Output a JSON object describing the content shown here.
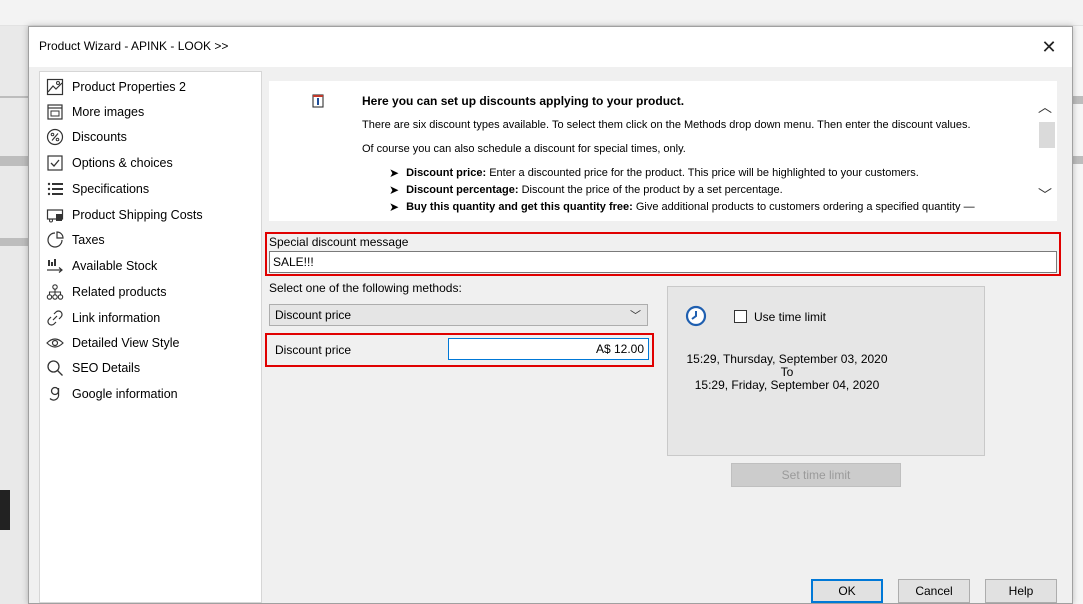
{
  "dialog": {
    "title": "Product Wizard - APINK - LOOK >>",
    "close": "✕"
  },
  "nav": {
    "items": [
      {
        "label": "Product Properties 2",
        "icon": "image-icon"
      },
      {
        "label": "More images",
        "icon": "gallery-icon"
      },
      {
        "label": "Discounts",
        "icon": "percent-icon"
      },
      {
        "label": "Options & choices",
        "icon": "checkbox-icon"
      },
      {
        "label": "Specifications",
        "icon": "list-icon"
      },
      {
        "label": "Product Shipping Costs",
        "icon": "truck-icon"
      },
      {
        "label": "Taxes",
        "icon": "pie-icon"
      },
      {
        "label": "Available Stock",
        "icon": "stock-icon"
      },
      {
        "label": "Related products",
        "icon": "hierarchy-icon"
      },
      {
        "label": "Link information",
        "icon": "link-icon"
      },
      {
        "label": "Detailed View Style",
        "icon": "eye-icon"
      },
      {
        "label": "SEO Details",
        "icon": "search-icon"
      },
      {
        "label": "Google information",
        "icon": "google-icon"
      }
    ]
  },
  "help": {
    "heading": "Here you can set up discounts applying to your product.",
    "p1": "There are six discount types available. To select them click on the Methods drop down menu. Then enter the discount values.",
    "p2": "Of course you can also schedule a discount for special times, only.",
    "bullets": [
      {
        "term": "Discount price:",
        "text": "Enter a discounted price for the product. This price will be highlighted to your customers."
      },
      {
        "term": "Discount percentage:",
        "text": "Discount the price of the product by a set percentage."
      },
      {
        "term": "Buy this quantity and get this quantity free:",
        "text": "Give additional products to customers ordering a specified quantity —"
      }
    ]
  },
  "discount_message": {
    "label": "Special discount message",
    "value": "SALE!!!"
  },
  "methods": {
    "label": "Select one of the following methods:",
    "selected": "Discount price"
  },
  "discount_price": {
    "label": "Discount price",
    "value": "A$ 12.00"
  },
  "time_limit": {
    "checkbox_label": "Use time limit",
    "start": "15:29, Thursday, September 03, 2020",
    "to": "To",
    "end": "15:29, Friday, September 04, 2020",
    "button": "Set time limit"
  },
  "footer": {
    "ok": "OK",
    "cancel": "Cancel",
    "help": "Help"
  },
  "colors": {
    "highlight_red": "#e00000",
    "accent_blue": "#0078d7"
  }
}
